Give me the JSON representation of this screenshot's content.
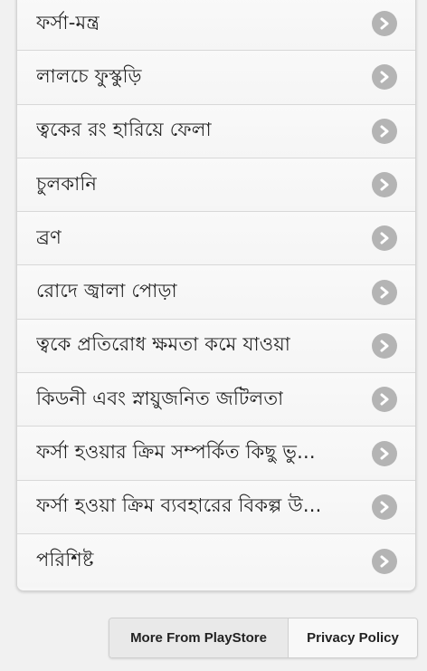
{
  "menu": {
    "items": [
      {
        "label": "ফর্সা-মন্ত্র"
      },
      {
        "label": "লালচে ফুস্কুড়ি"
      },
      {
        "label": "ত্বকের রং হারিয়ে ফেলা"
      },
      {
        "label": "চুলকানি"
      },
      {
        "label": "ব্রণ"
      },
      {
        "label": "রোদে জ্বালা পোড়া"
      },
      {
        "label": "ত্বকে প্রতিরোধ ক্ষমতা কমে যাওয়া"
      },
      {
        "label": "কিডনী এবং স্নায়ুজনিত জটিলতা"
      },
      {
        "label": "ফর্সা হওয়ার ক্রিম সম্পর্কিত কিছু ভু..."
      },
      {
        "label": "ফর্সা হওয়া ক্রিম ব্যবহারের বিকল্প উ..."
      },
      {
        "label": "পরিশিষ্ট"
      }
    ],
    "item_icon": "chevron-right-circle-icon"
  },
  "footer": {
    "playstore_label": "More From PlayStore",
    "privacy_label": "Privacy Policy"
  },
  "colors": {
    "background": "#f1f1f1",
    "card": "#f7f7f7",
    "chevron": "#b4b4b4"
  }
}
